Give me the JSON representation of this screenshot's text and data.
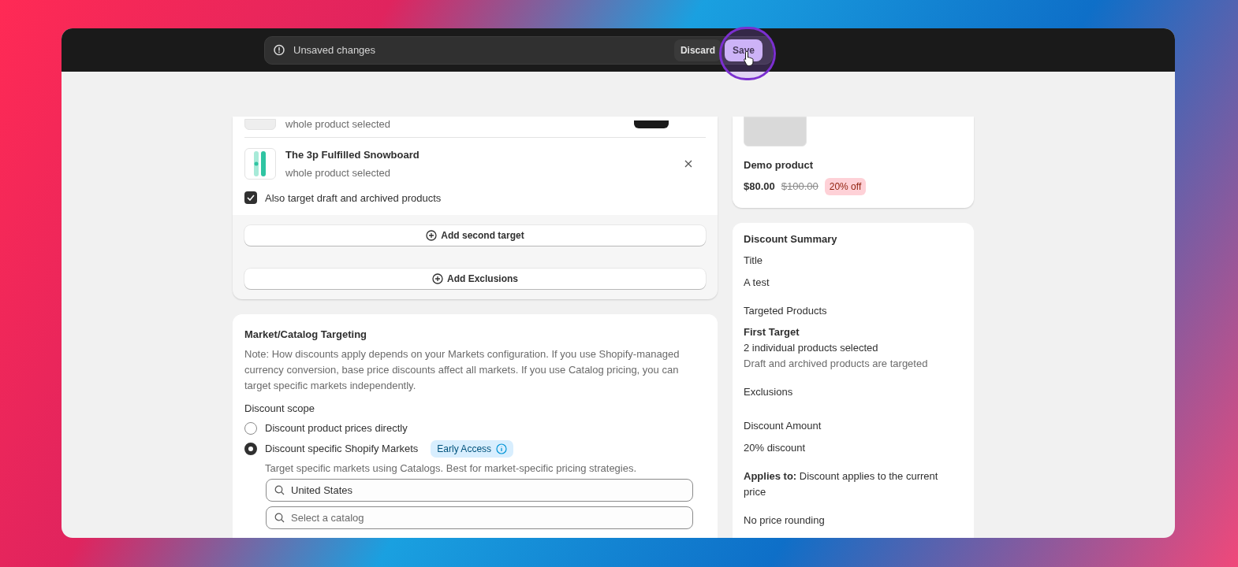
{
  "save_bar": {
    "message": "Unsaved changes",
    "buttons": [
      {
        "label": "Discard",
        "kind": "secondary"
      },
      {
        "label": "Save",
        "kind": "primary"
      }
    ]
  },
  "targets": {
    "products": [
      {
        "kind": "blank",
        "subtitle": "whole product selected"
      },
      {
        "kind": "snowboard",
        "name": "The 3p Fulfilled Snowboard",
        "subtitle": "whole product selected"
      }
    ],
    "include_drafts": {
      "label": "Also target draft and archived products",
      "checked": true
    },
    "actions": [
      "Add second target",
      "Add Exclusions"
    ]
  },
  "market": {
    "title": "Market/Catalog Targeting",
    "note": "Note: How discounts apply depends on your Markets configuration. If you use Shopify-managed currency conversion, base price discounts affect all markets. If you use Catalog pricing, you can target specific markets independently.",
    "scope_label": "Discount scope",
    "options": [
      {
        "label": "Discount product prices directly",
        "selected": false
      },
      {
        "label": "Discount specific Shopify Markets",
        "selected": true,
        "badge": "Early Access",
        "description": "Target specific markets using Catalogs. Best for market-specific pricing strategies."
      }
    ],
    "fields": [
      {
        "value": "United States"
      },
      {
        "placeholder": "Select a catalog"
      }
    ]
  },
  "preview": {
    "name": "Demo product",
    "price": "$80.00",
    "compare_price": "$100.00",
    "discount_badge": "20% off"
  },
  "summary": {
    "title": "Discount Summary",
    "entries": [
      {
        "kind": "heading",
        "text": "Title"
      },
      {
        "kind": "text",
        "text": "A test"
      },
      {
        "kind": "heading",
        "text": "Targeted Products"
      },
      {
        "kind": "subheading",
        "text": "First Target"
      },
      {
        "kind": "line",
        "text": "2 individual products selected"
      },
      {
        "kind": "muted",
        "text": "Draft and archived products are targeted"
      },
      {
        "kind": "heading",
        "text": "Exclusions"
      },
      {
        "kind": "heading",
        "text": "Discount Amount"
      },
      {
        "kind": "text",
        "text": "20% discount"
      },
      {
        "kind": "text",
        "text": "**Applies to:** Discount applies to the current price"
      },
      {
        "kind": "text",
        "text": "No price rounding"
      }
    ]
  }
}
